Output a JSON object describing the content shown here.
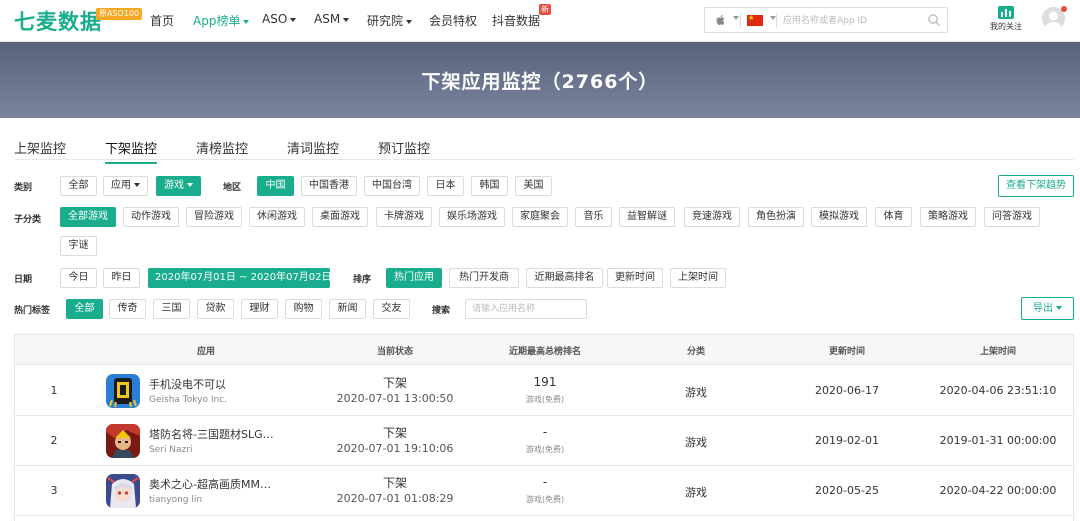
{
  "header": {
    "logo": "七麦数据",
    "logo_badge": "原ASO100",
    "nav": [
      {
        "label": "首页"
      },
      {
        "label": "App榜单"
      },
      {
        "label": "ASO"
      },
      {
        "label": "ASM"
      },
      {
        "label": "研究院"
      },
      {
        "label": "会员特权"
      },
      {
        "label": "抖音数据"
      }
    ],
    "new_badge": "新",
    "search_placeholder": "应用名称或者App ID",
    "follow_label": "我的关注",
    "accent_color": "#1aad8d"
  },
  "banner": {
    "title": "下架应用监控（2766个）"
  },
  "tabs": [
    "上架监控",
    "下架监控",
    "清榜监控",
    "清词监控",
    "预订监控"
  ],
  "filters": {
    "category_label": "类别",
    "category": [
      "全部",
      "应用",
      "游戏"
    ],
    "region_label": "地区",
    "regions": [
      "中国",
      "中国香港",
      "中国台湾",
      "日本",
      "韩国",
      "美国"
    ],
    "trend_button": "查看下架趋势",
    "subcategory_label": "子分类",
    "subcategories": [
      "全部游戏",
      "动作游戏",
      "冒险游戏",
      "休闲游戏",
      "桌面游戏",
      "卡牌游戏",
      "娱乐场游戏",
      "家庭聚会",
      "音乐",
      "益智解谜",
      "竞速游戏",
      "角色扮演",
      "模拟游戏",
      "体育",
      "策略游戏",
      "问答游戏",
      "字谜"
    ],
    "date_label": "日期",
    "date_today": "今日",
    "date_yesterday": "昨日",
    "date_range": "2020年07月01日 ~ 2020年07月02日",
    "sort_label": "排序",
    "sort_options": [
      "热门应用",
      "热门开发商",
      "近期最高排名",
      "更新时间",
      "上架时间"
    ],
    "tag_label": "热门标签",
    "tags": [
      "全部",
      "传奇",
      "三国",
      "贷款",
      "理财",
      "购物",
      "新闻",
      "交友"
    ],
    "keyword_label": "搜索",
    "keyword_placeholder": "请输入应用名称",
    "export_button": "导出"
  },
  "table": {
    "headers": [
      "应用",
      "当前状态",
      "近期最高总榜排名",
      "分类",
      "更新时间",
      "上架时间"
    ],
    "rows": [
      {
        "index": "1",
        "name": "手机没电不可以",
        "developer": "Geisha Tokyo Inc.",
        "status": "下架",
        "status_time": "2020-07-01 13:00:50",
        "rank": "191",
        "rank_sub": "游戏(免费)",
        "category": "游戏",
        "updated": "2020-06-17",
        "released": "2020-04-06 23:51:10"
      },
      {
        "index": "2",
        "name": "塔防名将-三国题材SLG…",
        "developer": "Seri Nazri",
        "status": "下架",
        "status_time": "2020-07-01 19:10:06",
        "rank": "-",
        "rank_sub": "游戏(免费)",
        "category": "游戏",
        "updated": "2019-02-01",
        "released": "2019-01-31 00:00:00"
      },
      {
        "index": "3",
        "name": "奥术之心-超高画质MM…",
        "developer": "tianyong lin",
        "status": "下架",
        "status_time": "2020-07-01 01:08:29",
        "rank": "-",
        "rank_sub": "游戏(免费)",
        "category": "游戏",
        "updated": "2020-05-25",
        "released": "2020-04-22 00:00:00"
      }
    ]
  }
}
